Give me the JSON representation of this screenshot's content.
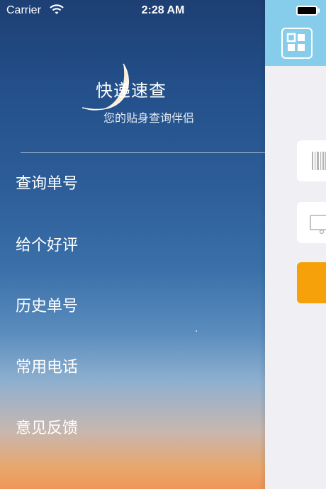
{
  "status_bar": {
    "carrier": "Carrier",
    "time": "2:28 AM",
    "wifi_icon": "wifi-icon",
    "battery_icon": "battery-icon"
  },
  "menu": {
    "title": "快递速查",
    "subtitle": "您的贴身查询伴侣",
    "items": [
      {
        "label": "查询单号"
      },
      {
        "label": "给个好评"
      },
      {
        "label": "历史单号"
      },
      {
        "label": "常用电话"
      },
      {
        "label": "意见反馈"
      }
    ]
  },
  "main": {
    "nav_icon": "grid-menu-icon",
    "barcode_icon": "barcode-icon",
    "box_icon": "package-icon"
  },
  "colors": {
    "nav_bar": "#86cdec",
    "accent_button": "#f6a10a",
    "panel_bg": "#efeff4"
  }
}
